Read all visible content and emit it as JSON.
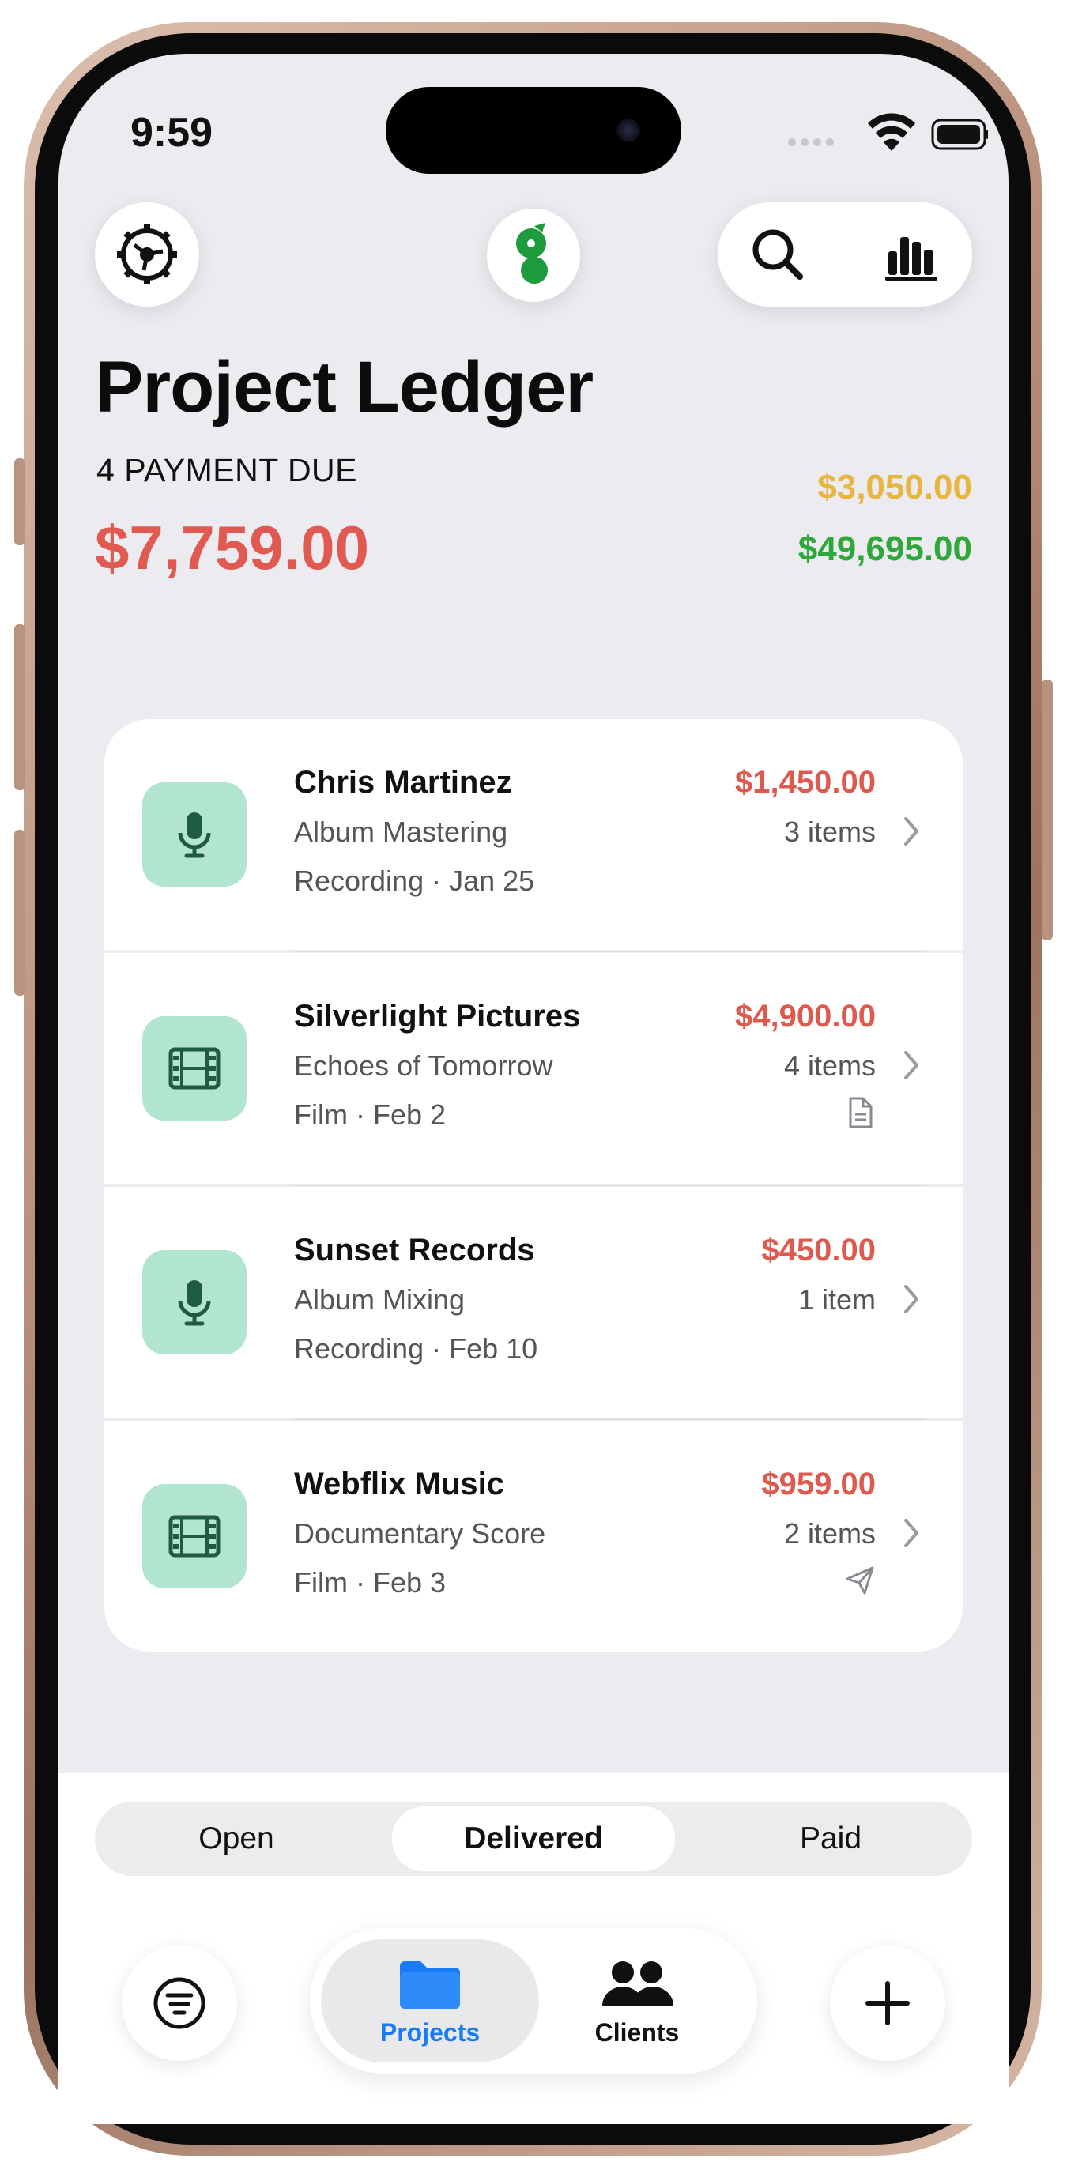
{
  "status_bar": {
    "time": "9:59"
  },
  "header": {
    "title": "Project Ledger",
    "due_label": "4 PAYMENT DUE",
    "due_amount": "$7,759.00",
    "pending_amount": "$3,050.00",
    "paid_amount": "$49,695.00",
    "colors": {
      "due": "#e05a51",
      "pending": "#e7b540",
      "paid": "#2fa83b"
    }
  },
  "toolbar": {
    "settings_icon": "gear-icon",
    "logo_icon": "app-logo",
    "search_icon": "search-icon",
    "stats_icon": "bar-chart-icon"
  },
  "projects": [
    {
      "client": "Chris Martinez",
      "project": "Album Mastering",
      "category": "Recording",
      "date": "Jan 25",
      "meta": "Recording · Jan 25",
      "amount": "$1,450.00",
      "items": "3 items",
      "icon": "microphone-icon",
      "status_icon": ""
    },
    {
      "client": "Silverlight Pictures",
      "project": "Echoes of Tomorrow",
      "category": "Film",
      "date": "Feb 2",
      "meta": "Film · Feb 2",
      "amount": "$4,900.00",
      "items": "4 items",
      "icon": "film-icon",
      "status_icon": "document-icon"
    },
    {
      "client": "Sunset Records",
      "project": "Album Mixing",
      "category": "Recording",
      "date": "Feb 10",
      "meta": "Recording · Feb 10",
      "amount": "$450.00",
      "items": "1 item",
      "icon": "microphone-icon",
      "status_icon": ""
    },
    {
      "client": "Webflix Music",
      "project": "Documentary Score",
      "category": "Film",
      "date": "Feb 3",
      "meta": "Film · Feb 3",
      "amount": "$959.00",
      "items": "2 items",
      "icon": "film-icon",
      "status_icon": "send-icon"
    }
  ],
  "segments": {
    "options": [
      "Open",
      "Delivered",
      "Paid"
    ],
    "selected": "Delivered"
  },
  "tabbar": {
    "tabs": [
      {
        "label": "Projects",
        "icon": "folder-icon",
        "active": true,
        "color": "#1a7cf5"
      },
      {
        "label": "Clients",
        "icon": "people-icon",
        "active": false,
        "color": "#111111"
      }
    ],
    "filter_icon": "filter-icon",
    "add_icon": "plus-icon"
  }
}
